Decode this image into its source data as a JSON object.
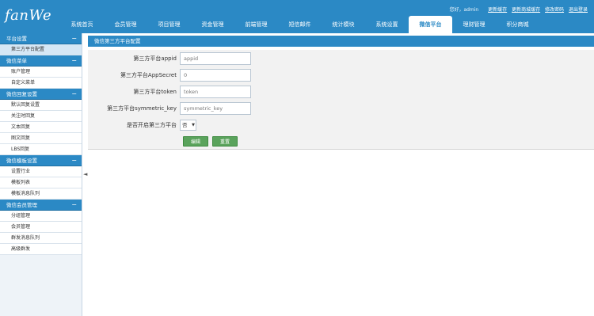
{
  "app": {
    "logo": "fanWe"
  },
  "top_links": {
    "greeting": "您好，admin",
    "links": [
      "更新缓存",
      "更新商城缓存",
      "修改密码",
      "退出登录"
    ]
  },
  "nav": {
    "items": [
      "系统首页",
      "会员管理",
      "项目管理",
      "资金管理",
      "前端管理",
      "短信邮件",
      "统计模块",
      "系统设置",
      "微信平台",
      "理财管理",
      "积分商城"
    ],
    "active_index": 8
  },
  "sidebar": {
    "sections": [
      {
        "title": "平台设置",
        "items": [
          "第三方平台配置"
        ]
      },
      {
        "title": "微信菜单",
        "items": [
          "账户管理",
          "自定义菜单"
        ]
      },
      {
        "title": "微信回复设置",
        "items": [
          "默认回复设置",
          "关注时回复",
          "文本回复",
          "图文回复",
          "LBS回复"
        ]
      },
      {
        "title": "微信模板设置",
        "items": [
          "设置行业",
          "模板列表",
          "模板消息队列"
        ]
      },
      {
        "title": "微信会员管理",
        "items": [
          "分组管理",
          "会员管理",
          "群发消息队列",
          "高级群发"
        ]
      }
    ],
    "collapse_icon": "◄"
  },
  "content": {
    "title": "微信第三方平台配置",
    "fields": [
      {
        "label": "第三方平台appid",
        "value": "appid"
      },
      {
        "label": "第三方平台AppSecret",
        "value": "0"
      },
      {
        "label": "第三方平台token",
        "value": "token"
      },
      {
        "label": "第三方平台symmetric_key",
        "value": "symmetric_key"
      }
    ],
    "toggle": {
      "label": "是否开启第三方平台",
      "value": "否"
    },
    "buttons": {
      "submit": "编辑",
      "reset": "重置"
    }
  },
  "colors": {
    "primary": "#2b89c5",
    "button_green": "#5aa35c"
  }
}
